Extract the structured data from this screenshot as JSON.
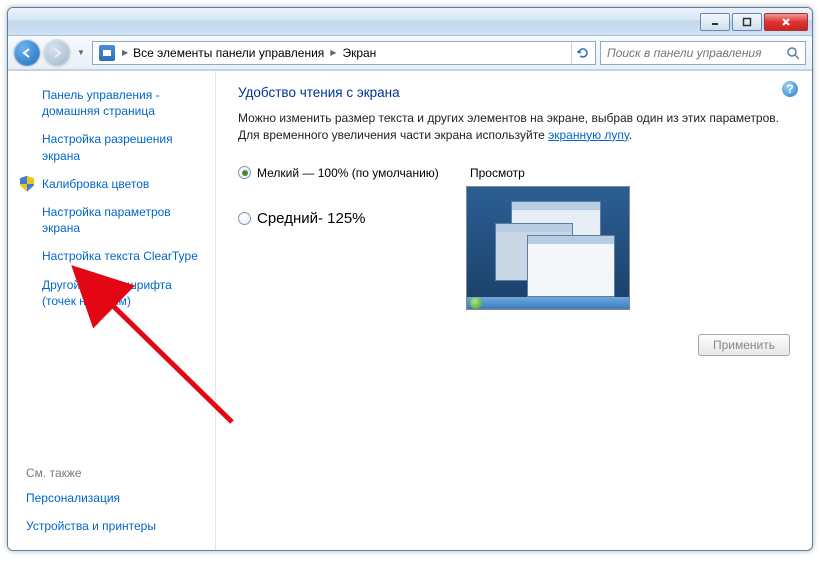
{
  "breadcrumb": {
    "level1": "Все элементы панели управления",
    "level2": "Экран"
  },
  "search": {
    "placeholder": "Поиск в панели управления"
  },
  "sidebar": {
    "items": [
      "Панель управления - домашняя страница",
      "Настройка разрешения экрана",
      "Калибровка цветов",
      "Настройка параметров экрана",
      "Настройка текста ClearType",
      "Другой размер шрифта (точек на дюйм)"
    ],
    "see_also_heading": "См. также",
    "see_also": [
      "Персонализация",
      "Устройства и принтеры"
    ]
  },
  "main": {
    "title": "Удобство чтения с экрана",
    "desc_part1": "Можно изменить размер текста и других элементов на экране, выбрав один из этих параметров. Для временного увеличения части экрана используйте ",
    "desc_link": "экранную лупу",
    "desc_part2": ".",
    "option_small": "Мелкий — 100% (по умолчанию)",
    "option_medium": "Средний- 125%",
    "preview_label": "Просмотр",
    "apply": "Применить"
  }
}
